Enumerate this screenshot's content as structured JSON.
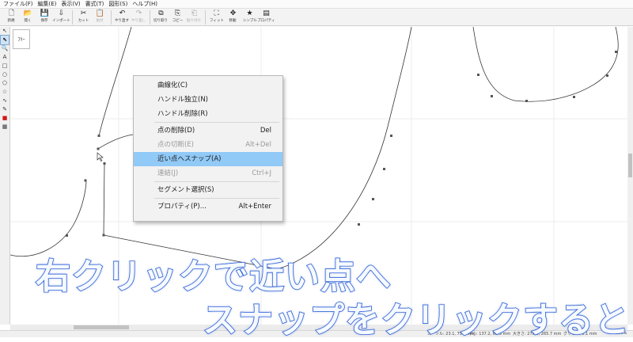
{
  "menu": [
    "ファイル(F)",
    "編集(E)",
    "表示(V)",
    "書式(T)",
    "図形(S)",
    "ヘルプ(H)"
  ],
  "toolbar": [
    {
      "icon": "new-file-icon",
      "glyph": "🗋",
      "label": "新規",
      "disabled": false
    },
    {
      "icon": "open-folder-icon",
      "glyph": "📂",
      "label": "開く",
      "disabled": false
    },
    {
      "icon": "save-icon",
      "glyph": "💾",
      "label": "保存",
      "disabled": false
    },
    {
      "icon": "import-icon",
      "glyph": "⇩",
      "label": "インポート",
      "disabled": false
    },
    {
      "sep": true
    },
    {
      "icon": "cut-icon",
      "glyph": "✂",
      "label": "カット",
      "disabled": false
    },
    {
      "icon": "paste-icon",
      "glyph": "📋",
      "label": "貼付",
      "disabled": true
    },
    {
      "sep": true
    },
    {
      "icon": "undo-icon",
      "glyph": "↶",
      "label": "やり直す",
      "disabled": false
    },
    {
      "icon": "redo-icon",
      "glyph": "↷",
      "label": "やり直し",
      "disabled": true
    },
    {
      "sep": true
    },
    {
      "icon": "split-icon",
      "glyph": "⧉",
      "label": "切り取り",
      "disabled": false
    },
    {
      "icon": "copy-icon",
      "glyph": "⎘",
      "label": "コピー",
      "disabled": false
    },
    {
      "icon": "paste-special-icon",
      "glyph": "⎗",
      "label": "貼り付け",
      "disabled": true
    },
    {
      "sep": true
    },
    {
      "icon": "fit-icon",
      "glyph": "⛶",
      "label": "フィット",
      "disabled": false
    },
    {
      "icon": "move-icon",
      "glyph": "✥",
      "label": "移動",
      "disabled": false
    },
    {
      "icon": "simple-icon",
      "glyph": "★",
      "label": "シンプル",
      "disabled": false
    },
    {
      "icon": "properties-icon",
      "glyph": "▤",
      "label": "プロパティ",
      "disabled": false
    }
  ],
  "tools": [
    {
      "icon": "arrow-select-icon",
      "glyph": "↖",
      "active": false
    },
    {
      "icon": "node-select-icon",
      "glyph": "⬉",
      "active": true
    },
    {
      "icon": "zoom-icon",
      "glyph": "🔍",
      "active": false
    },
    {
      "icon": "text-tool-icon",
      "glyph": "A",
      "active": false
    },
    {
      "icon": "rectangle-tool-icon",
      "glyph": "□",
      "active": false
    },
    {
      "icon": "ellipse-tool-icon",
      "glyph": "○",
      "active": false
    },
    {
      "icon": "polygon-tool-icon",
      "glyph": "⬠",
      "active": false
    },
    {
      "icon": "star-tool-icon",
      "glyph": "☆",
      "active": false
    },
    {
      "icon": "curve-tool-icon",
      "glyph": "∿",
      "active": false
    },
    {
      "icon": "pen-tool-icon",
      "glyph": "✎",
      "active": false
    },
    {
      "icon": "color-swatch-icon",
      "glyph": "■",
      "active": false
    },
    {
      "icon": "grid-icon",
      "glyph": "▦",
      "active": false
    }
  ],
  "thumbnail": {
    "label": "ﾌﾘｰ"
  },
  "context_menu": {
    "items": [
      {
        "label": "曲線化(C)",
        "shortcut": "",
        "disabled": false,
        "highlight": false
      },
      {
        "label": "ハンドル独立(N)",
        "shortcut": "",
        "disabled": false,
        "highlight": false
      },
      {
        "label": "ハンドル削除(R)",
        "shortcut": "",
        "disabled": false,
        "highlight": false
      },
      {
        "sep": true
      },
      {
        "label": "点の削除(D)",
        "shortcut": "Del",
        "disabled": false,
        "highlight": false
      },
      {
        "label": "点の切断(E)",
        "shortcut": "Alt+Del",
        "disabled": true,
        "highlight": false
      },
      {
        "label": "近い点へスナップ(A)",
        "shortcut": "",
        "disabled": false,
        "highlight": true
      },
      {
        "label": "連結(J)",
        "shortcut": "Ctrl+J",
        "disabled": true,
        "highlight": false
      },
      {
        "sep": true
      },
      {
        "label": "セグメント選択(S)",
        "shortcut": "",
        "disabled": false,
        "highlight": false
      },
      {
        "sep": true
      },
      {
        "label": "プロパティ(P)...",
        "shortcut": "Alt+Enter",
        "disabled": false,
        "highlight": false
      }
    ]
  },
  "captions": {
    "line1": "右クリックで近い点へ",
    "line2": "スナップをクリックすると"
  },
  "status": {
    "cursor": "カーソル: 23.1, 75.8 mm",
    "center": "中心: 137.2, 65.5 mm",
    "size": "大きさ: 270.0, 265.7 mm",
    "grid": "グリッド: 5.1 mm",
    "zoom": "200%"
  },
  "colors": {
    "caption_stroke": "#2f63d8",
    "highlight": "#91c9f7"
  }
}
